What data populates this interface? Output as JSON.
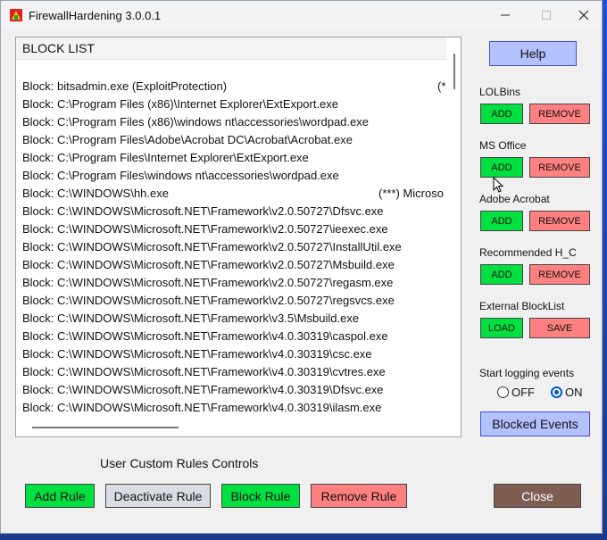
{
  "window": {
    "title": "FirewallHardening 3.0.0.1"
  },
  "list": {
    "header": "BLOCK  LIST",
    "rows": [
      "Block: bitsadmin.exe (ExploitProtection)",
      "Block: C:\\Program Files (x86)\\Internet Explorer\\ExtExport.exe",
      "Block: C:\\Program Files (x86)\\windows nt\\accessories\\wordpad.exe",
      "Block: C:\\Program Files\\Adobe\\Acrobat DC\\Acrobat\\Acrobat.exe",
      "Block: C:\\Program Files\\Internet Explorer\\ExtExport.exe",
      "Block: C:\\Program Files\\windows nt\\accessories\\wordpad.exe",
      "Block: C:\\WINDOWS\\hh.exe",
      "Block: C:\\WINDOWS\\Microsoft.NET\\Framework\\v2.0.50727\\Dfsvc.exe",
      "Block: C:\\WINDOWS\\Microsoft.NET\\Framework\\v2.0.50727\\ieexec.exe",
      "Block: C:\\WINDOWS\\Microsoft.NET\\Framework\\v2.0.50727\\InstallUtil.exe",
      "Block: C:\\WINDOWS\\Microsoft.NET\\Framework\\v2.0.50727\\Msbuild.exe",
      "Block: C:\\WINDOWS\\Microsoft.NET\\Framework\\v2.0.50727\\regasm.exe",
      "Block: C:\\WINDOWS\\Microsoft.NET\\Framework\\v2.0.50727\\regsvcs.exe",
      "Block: C:\\WINDOWS\\Microsoft.NET\\Framework\\v3.5\\Msbuild.exe",
      "Block: C:\\WINDOWS\\Microsoft.NET\\Framework\\v4.0.30319\\caspol.exe",
      "Block: C:\\WINDOWS\\Microsoft.NET\\Framework\\v4.0.30319\\csc.exe",
      "Block: C:\\WINDOWS\\Microsoft.NET\\Framework\\v4.0.30319\\cvtres.exe",
      "Block: C:\\WINDOWS\\Microsoft.NET\\Framework\\v4.0.30319\\Dfsvc.exe",
      "Block: C:\\WINDOWS\\Microsoft.NET\\Framework\\v4.0.30319\\ilasm.exe"
    ],
    "row0_suffix": "(*",
    "row6_suffix": "(***)  Microso"
  },
  "side": {
    "help": "Help",
    "lolbins_label": "LOLBins",
    "msoffice_label": "MS Office",
    "acrobat_label": "Adobe Acrobat",
    "recommended_label": "Recommended H_C",
    "external_label": "External BlockList",
    "add": "ADD",
    "remove": "REMOVE",
    "load": "LOAD",
    "save": "SAVE",
    "logging_label": "Start logging events",
    "off": "OFF",
    "on": "ON",
    "logging_selected": "ON",
    "blocked_events": "Blocked Events"
  },
  "bottom": {
    "controls_label": "User Custom Rules Controls",
    "add_rule": "Add Rule",
    "deactivate_rule": "Deactivate Rule",
    "block_rule": "Block Rule",
    "remove_rule": "Remove Rule",
    "close": "Close"
  },
  "colors": {
    "green": "#00e040",
    "red": "#ff8080",
    "blue": "#b3c1ff",
    "brown": "#7e5d52",
    "gray": "#d8dde3"
  }
}
